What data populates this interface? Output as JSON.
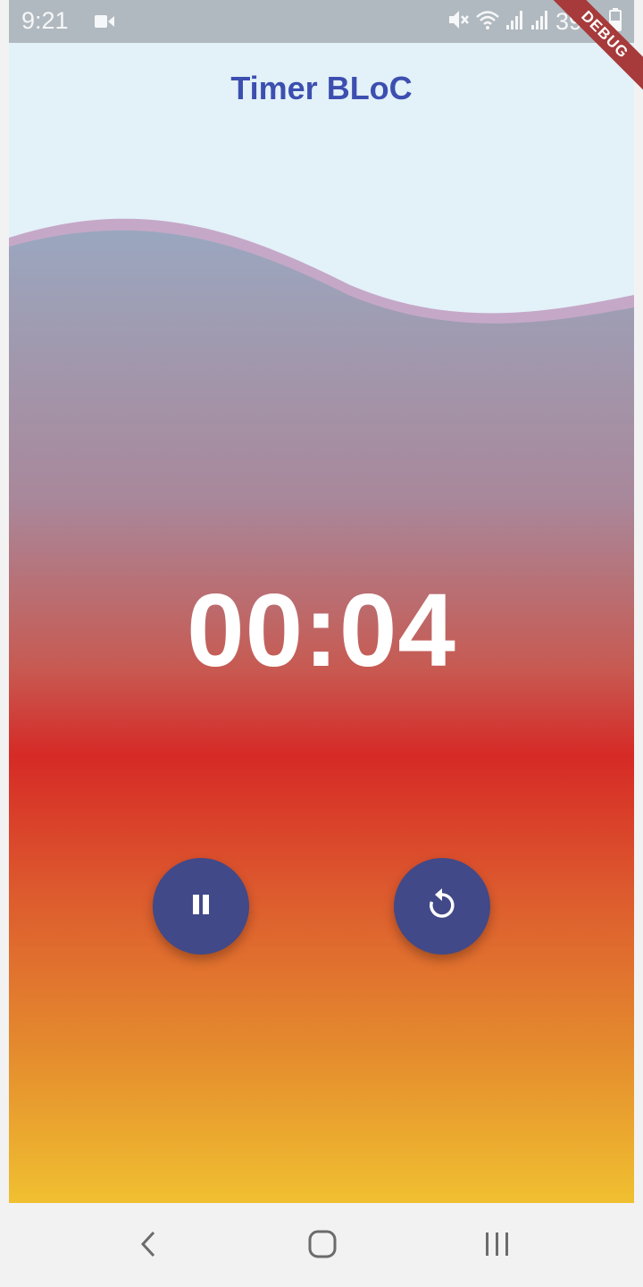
{
  "status_bar": {
    "time": "9:21",
    "battery_text": "39%",
    "icons": [
      "video-record-icon",
      "mute-icon",
      "wifi-icon",
      "signal-icon",
      "signal-icon",
      "battery-icon"
    ]
  },
  "app": {
    "title": "Timer BLoC",
    "timer": "00:04",
    "debug_banner": "DEBUG",
    "buttons": [
      {
        "name": "pause-button",
        "icon": "pause-icon"
      },
      {
        "name": "reset-button",
        "icon": "replay-icon"
      }
    ]
  },
  "colors": {
    "title": "#3c4fb0",
    "fab": "#414988",
    "gradient_top": "#9aa7bf",
    "gradient_mid": "#d62a26",
    "gradient_bottom": "#f0c030",
    "app_bg": "#e3f1f8",
    "debug": "#a73a3a"
  },
  "nav_bar": {
    "items": [
      "back-icon",
      "home-icon",
      "recent-apps-icon"
    ]
  }
}
